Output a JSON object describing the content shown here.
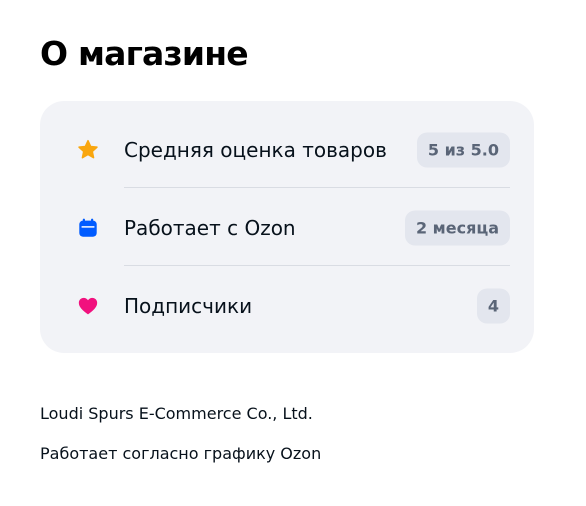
{
  "page": {
    "title": "О магазине"
  },
  "stats": [
    {
      "icon": "star-icon",
      "label": "Средняя оценка товаров",
      "value": "5 из 5.0"
    },
    {
      "icon": "calendar-icon",
      "label": "Работает с Ozon",
      "value": "2 месяца"
    },
    {
      "icon": "heart-icon",
      "label": "Подписчики",
      "value": "4"
    }
  ],
  "footer": {
    "company": "Loudi Spurs E-Commerce Co., Ltd.",
    "schedule": "Работает согласно графику Ozon"
  },
  "colors": {
    "star": "#f9a60f",
    "calendar": "#005bff",
    "heart": "#f1117e",
    "card_bg": "#f2f3f7",
    "badge_bg": "#e3e6ee"
  }
}
